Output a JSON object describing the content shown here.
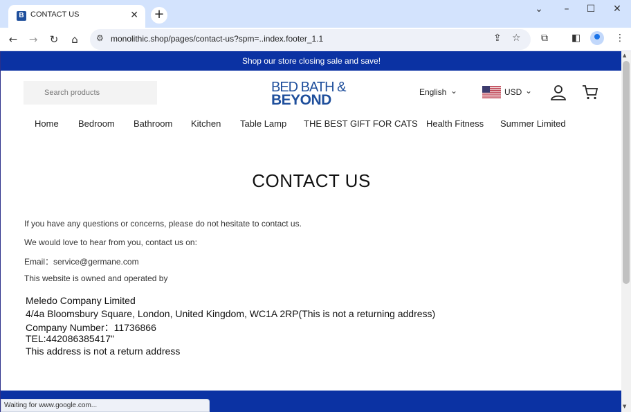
{
  "browser": {
    "tab_title": "CONTACT US",
    "tab_favicon_letter": "B",
    "url": "monolithic.shop/pages/contact-us?spm=..index.footer_1.1",
    "status_text": "Waiting for www.google.com..."
  },
  "page": {
    "promo_text": "Shop our store closing sale and save!",
    "search_placeholder": "Search products",
    "logo_line1": "BED BATH &",
    "logo_line2": "BEYOND",
    "language": "English",
    "currency": "USD",
    "nav": [
      "Home",
      "Bedroom",
      "Bathroom",
      "Kitchen",
      "Table Lamp",
      "THE BEST GIFT FOR CATS",
      "Health Fitness",
      "Summer Limited"
    ],
    "heading": "CONTACT US",
    "paragraphs": [
      "If you have any questions or concerns, please do not hesitate to contact us.",
      "We would love to hear from you, contact us on:",
      "Email：service@germane.com",
      "This website is owned and operated by"
    ],
    "address_lines": [
      "Meledo Company Limited",
      "4/4a Bloomsbury Square, London, United Kingdom, WC1A 2RP(This is not a returning address)",
      "Company Number：11736866",
      "TEL:442086385417\"",
      "This address is not a return address"
    ]
  },
  "colors": {
    "brand_blue": "#0b32a3",
    "logo_blue": "#1f4f9c",
    "tabbar": "#d3e3fd"
  }
}
